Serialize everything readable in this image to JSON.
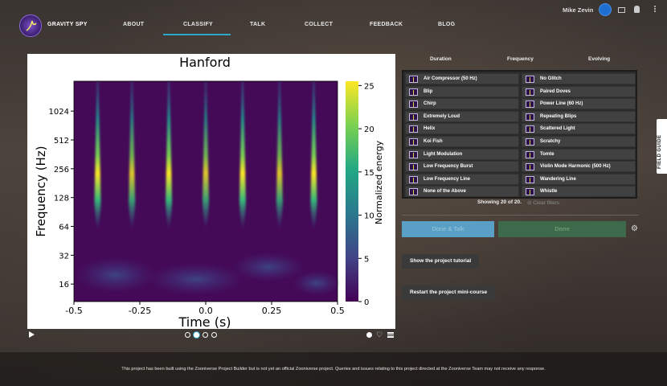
{
  "header": {
    "brand": "GRAVITY SPY",
    "nav": [
      {
        "label": "ABOUT"
      },
      {
        "label": "CLASSIFY"
      },
      {
        "label": "TALK"
      },
      {
        "label": "COLLECT"
      },
      {
        "label": "FEEDBACK"
      },
      {
        "label": "BLOG"
      }
    ],
    "active_nav": "CLASSIFY",
    "username": "Mike Zevin",
    "icons": [
      "gravity-spy-logo",
      "avatar",
      "mail-icon",
      "bell-icon",
      "menu-icon"
    ]
  },
  "subject": {
    "title": "Hanford",
    "xlabel": "Time (s)",
    "ylabel": "Frequency (Hz)",
    "colorbar_label": "Normalized energy",
    "frames": 4,
    "active_frame": 2
  },
  "chart_data": {
    "type": "heatmap",
    "title": "Hanford",
    "xlabel": "Time (s)",
    "ylabel": "Frequency (Hz)",
    "x_ticks": [
      "-0.5",
      "-0.25",
      "0.0",
      "0.25",
      "0.5"
    ],
    "xlim": [
      -0.5,
      0.5
    ],
    "y_ticks": [
      "16",
      "32",
      "64",
      "128",
      "256",
      "512",
      "1024"
    ],
    "y_scale": "log",
    "colorbar": {
      "label": "Normalized energy",
      "ticks": [
        "0",
        "5",
        "10",
        "15",
        "20",
        "25"
      ],
      "range": [
        0,
        25.5
      ],
      "colormap": "viridis"
    },
    "events": [
      {
        "time": -0.41,
        "peak_energy": 24
      },
      {
        "time": -0.28,
        "peak_energy": 22
      },
      {
        "time": -0.14,
        "peak_energy": 25
      },
      {
        "time": 0.0,
        "peak_energy": 22
      },
      {
        "time": 0.14,
        "peak_energy": 25
      },
      {
        "time": 0.28,
        "peak_energy": 22
      },
      {
        "time": 0.41,
        "peak_energy": 24
      }
    ]
  },
  "filters": {
    "duration": "Duration",
    "frequency": "Frequency",
    "evolving": "Evolving"
  },
  "choices": [
    {
      "label": "Air Compressor (50 Hz)"
    },
    {
      "label": "No Glitch"
    },
    {
      "label": "Blip"
    },
    {
      "label": "Paired Doves"
    },
    {
      "label": "Chirp"
    },
    {
      "label": "Power Line (60 Hz)"
    },
    {
      "label": "Extremely Loud"
    },
    {
      "label": "Repeating Blips"
    },
    {
      "label": "Helix"
    },
    {
      "label": "Scattered Light"
    },
    {
      "label": "Koi Fish"
    },
    {
      "label": "Scratchy"
    },
    {
      "label": "Light Modulation"
    },
    {
      "label": "Tomte"
    },
    {
      "label": "Low Frequency Burst"
    },
    {
      "label": "Violin Mode Harmonic (500 Hz)"
    },
    {
      "label": "Low Frequency Line"
    },
    {
      "label": "Wandering Line"
    },
    {
      "label": "None of the Above"
    },
    {
      "label": "Whistle"
    }
  ],
  "showing": "Showing 20 of 20.",
  "clear_filters": "⊘ Clear filters",
  "buttons": {
    "done_talk": "Done & Talk",
    "done": "Done",
    "tutorial": "Show the project tutorial",
    "minicourse": "Restart the project mini-course",
    "field_guide": "FIELD GUIDE"
  },
  "footer": "This project has been built using the Zooniverse Project Builder but is not yet an official Zooniverse project. Queries and issues relating to this project directed at the Zooniverse Team may not receive any response."
}
